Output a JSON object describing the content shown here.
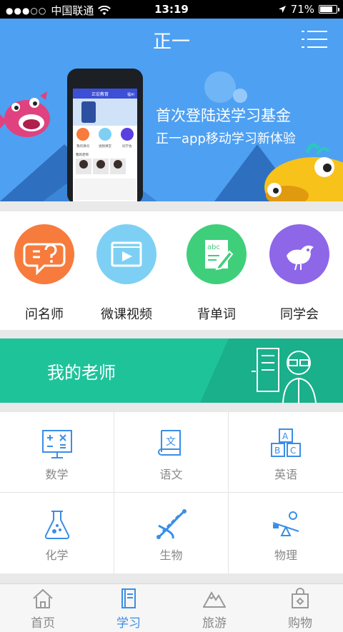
{
  "status_bar": {
    "signal": "●●●○○",
    "carrier": "中国联通",
    "time": "13:19",
    "battery_level": "71%"
  },
  "header": {
    "title": "正一",
    "menu_icon": "list-menu-icon"
  },
  "banner": {
    "line1": "首次登陆送学习基金",
    "line2": "正一app移动学习新体验",
    "phone_title": "正宏教育",
    "phone_city": "福州",
    "phone_entries": [
      "我的课问",
      "视频课堂",
      "同学会"
    ],
    "phone_section": "我的老师"
  },
  "quick_entries": [
    {
      "label": "问名师",
      "icon": "question-bubble-icon",
      "color": "#f77b3c"
    },
    {
      "label": "微课视频",
      "icon": "video-play-icon",
      "color": "#7dd0f4"
    },
    {
      "label": "背单词",
      "icon": "abc-notebook-icon",
      "color": "#3fcf7b"
    },
    {
      "label": "同学会",
      "icon": "bird-icon",
      "color": "#8d67e8"
    }
  ],
  "teacher_banner": {
    "label": "我的老师"
  },
  "subjects": [
    {
      "label": "数学",
      "icon": "math-board-icon"
    },
    {
      "label": "语文",
      "icon": "chinese-book-icon"
    },
    {
      "label": "英语",
      "icon": "abc-blocks-icon"
    },
    {
      "label": "化学",
      "icon": "flask-icon"
    },
    {
      "label": "生物",
      "icon": "dna-icon"
    },
    {
      "label": "物理",
      "icon": "seesaw-icon"
    }
  ],
  "tab_bar": [
    {
      "label": "首页",
      "icon": "home-icon",
      "active": false
    },
    {
      "label": "学习",
      "icon": "study-book-icon",
      "active": true
    },
    {
      "label": "旅游",
      "icon": "mountain-icon",
      "active": false
    },
    {
      "label": "购物",
      "icon": "shopping-bag-icon",
      "active": false
    }
  ],
  "colors": {
    "brand_blue": "#4ea0f2",
    "teacher_green": "#1ec39a",
    "subject_icon": "#3a8ee6",
    "tab_active": "#3a8ee6"
  }
}
